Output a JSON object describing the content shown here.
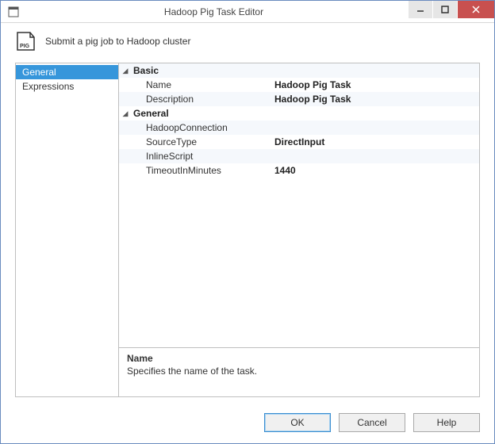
{
  "window": {
    "title": "Hadoop Pig Task Editor"
  },
  "header": {
    "subtitle": "Submit a pig job to Hadoop cluster"
  },
  "sidebar": {
    "items": [
      {
        "label": "General",
        "selected": true
      },
      {
        "label": "Expressions",
        "selected": false
      }
    ]
  },
  "properties": {
    "categories": [
      {
        "label": "Basic",
        "items": [
          {
            "label": "Name",
            "value": "Hadoop Pig Task",
            "bold": true
          },
          {
            "label": "Description",
            "value": "Hadoop Pig Task",
            "bold": true
          }
        ]
      },
      {
        "label": "General",
        "items": [
          {
            "label": "HadoopConnection",
            "value": "",
            "bold": false
          },
          {
            "label": "SourceType",
            "value": "DirectInput",
            "bold": true
          },
          {
            "label": "InlineScript",
            "value": "",
            "bold": false
          },
          {
            "label": "TimeoutInMinutes",
            "value": "1440",
            "bold": true
          }
        ]
      }
    ]
  },
  "description": {
    "title": "Name",
    "body": "Specifies the name of the task."
  },
  "buttons": {
    "ok": "OK",
    "cancel": "Cancel",
    "help": "Help"
  }
}
